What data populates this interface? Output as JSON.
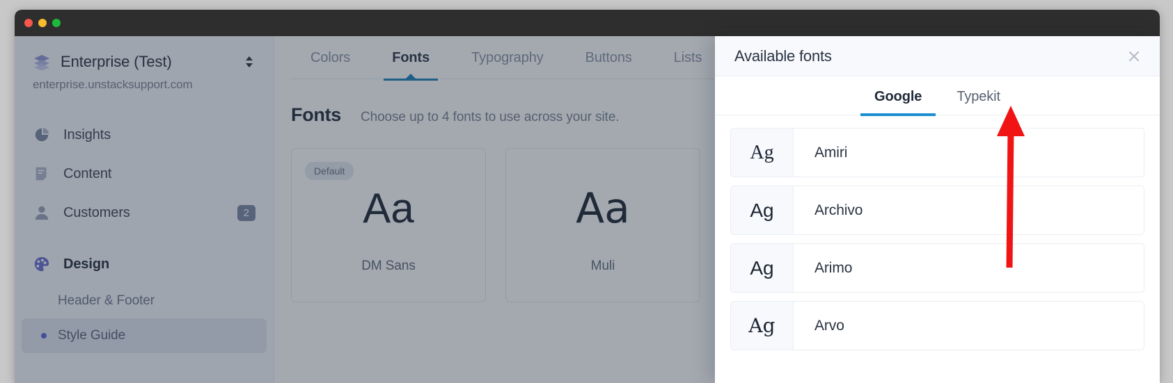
{
  "window": {
    "controls": [
      "close",
      "minimize",
      "zoom"
    ]
  },
  "sidebar": {
    "site_name": "Enterprise (Test)",
    "site_url": "enterprise.unstacksupport.com",
    "logo_icon": "layers-icon",
    "switcher_icon": "chevron-up-down-icon",
    "items": [
      {
        "label": "Insights",
        "icon": "pie-chart-icon",
        "badge": ""
      },
      {
        "label": "Content",
        "icon": "document-icon",
        "badge": ""
      },
      {
        "label": "Customers",
        "icon": "person-icon",
        "badge": "2"
      },
      {
        "label": "Design",
        "icon": "palette-icon",
        "badge": ""
      }
    ],
    "sub_items": [
      {
        "label": "Header & Footer",
        "selected": false
      },
      {
        "label": "Style Guide",
        "selected": true
      }
    ]
  },
  "main": {
    "tabs": [
      {
        "label": "Colors",
        "active": false
      },
      {
        "label": "Fonts",
        "active": true
      },
      {
        "label": "Typography",
        "active": false
      },
      {
        "label": "Buttons",
        "active": false
      },
      {
        "label": "Lists",
        "active": false
      }
    ],
    "section_title": "Fonts",
    "section_subtitle": "Choose up to 4 fonts to use across your site.",
    "font_cards": [
      {
        "badge": "Default",
        "sample": "Aa",
        "name": "DM Sans"
      },
      {
        "badge": "",
        "sample": "Aa",
        "name": "Muli"
      }
    ]
  },
  "panel": {
    "title": "Available fonts",
    "close_icon": "close-icon",
    "tabs": [
      {
        "label": "Google",
        "active": true
      },
      {
        "label": "Typekit",
        "active": false
      }
    ],
    "fonts": [
      {
        "sample": "Ag",
        "name": "Amiri",
        "style": "serif"
      },
      {
        "sample": "Ag",
        "name": "Archivo",
        "style": "sans"
      },
      {
        "sample": "Ag",
        "name": "Arimo",
        "style": "sans"
      },
      {
        "sample": "Ag",
        "name": "Arvo",
        "style": "slab"
      }
    ]
  },
  "annotation": {
    "arrow_color": "#f01414",
    "points_to": "Typekit"
  },
  "colors": {
    "accent_blue": "#1a8fd0",
    "tab_underline": "#1a7fb5",
    "sidebar_bg": "#f7f8fb",
    "badge_bg": "#7b85a4",
    "bullet": "#5c63d8"
  }
}
